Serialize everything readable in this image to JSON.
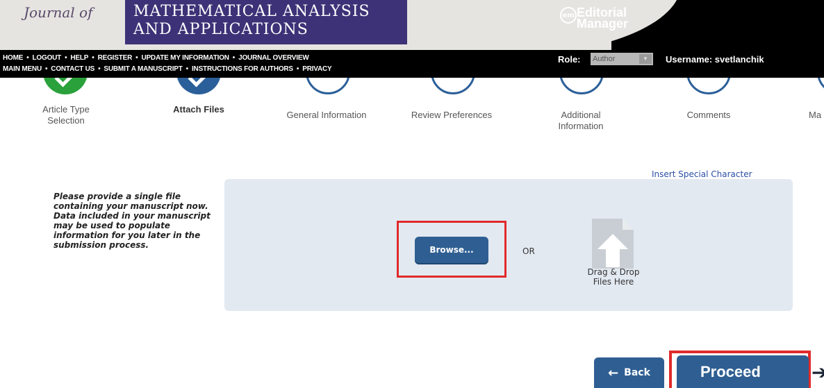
{
  "header": {
    "journal_prefix": "Journal of",
    "journal_line1": "MATHEMATICAL ANALYSIS",
    "journal_line2": "AND APPLICATIONS",
    "em_badge": "em",
    "em_line1": "Editorial",
    "em_line2": "Manager",
    "role_label": "Role:",
    "role_value": "Author",
    "username": "Username: svetlanchik",
    "nav_row1": [
      "HOME",
      "LOGOUT",
      "HELP",
      "REGISTER",
      "UPDATE MY INFORMATION",
      "JOURNAL OVERVIEW"
    ],
    "nav_row2": [
      "MAIN MENU",
      "CONTACT US",
      "SUBMIT A MANUSCRIPT",
      "INSTRUCTIONS FOR AUTHORS",
      "PRIVACY"
    ],
    "nav_separator": "•"
  },
  "steps": [
    {
      "label": "Article Type Selection",
      "state": "done"
    },
    {
      "label": "Attach Files",
      "state": "active"
    },
    {
      "label": "General Information",
      "state": "pending"
    },
    {
      "label": "Review Preferences",
      "state": "pending"
    },
    {
      "label": "Additional Information",
      "state": "pending"
    },
    {
      "label": "Comments",
      "state": "pending"
    },
    {
      "label": "Ma",
      "state": "pending"
    }
  ],
  "upload": {
    "special_char_link": "Insert Special Character",
    "instructions": "Please provide a single file containing your manuscript now. Data included in your manuscript may be used to populate information for you later in the submission process.",
    "browse_label": "Browse...",
    "or_label": "OR",
    "drag_line1": "Drag & Drop",
    "drag_line2": "Files Here"
  },
  "footer": {
    "back_label": "Back",
    "back_arrow": "←",
    "proceed_label": "Proceed",
    "proceed_arrow": "➔"
  },
  "colors": {
    "brand_purple": "#3d3277",
    "button_blue": "#2f5f92",
    "highlight_red": "#e02a2a",
    "step_done_green": "#2aa13b",
    "panel_bg": "#e3e9f1"
  }
}
